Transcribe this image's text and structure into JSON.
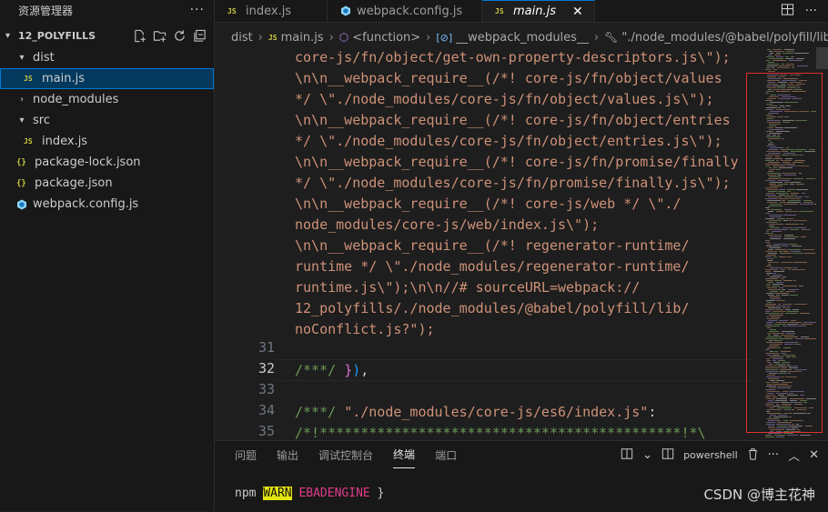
{
  "sidebar": {
    "title": "资源管理器",
    "more": "···",
    "project": "12_POLYFILLS",
    "items": [
      {
        "label": "dist",
        "type": "folder-open"
      },
      {
        "label": "main.js",
        "type": "js"
      },
      {
        "label": "node_modules",
        "type": "folder"
      },
      {
        "label": "src",
        "type": "folder-open"
      },
      {
        "label": "index.js",
        "type": "js"
      },
      {
        "label": "package-lock.json",
        "type": "json"
      },
      {
        "label": "package.json",
        "type": "json"
      },
      {
        "label": "webpack.config.js",
        "type": "webpack"
      }
    ]
  },
  "tabs": [
    {
      "label": "index.js",
      "icon": "JS"
    },
    {
      "label": "webpack.config.js",
      "icon": "webpack-icon"
    },
    {
      "label": "main.js",
      "icon": "JS",
      "active": true,
      "close": "✕"
    }
  ],
  "breadcrumb": {
    "parts": [
      "dist",
      "main.js",
      "<function>",
      "__webpack_modules__",
      "\"./node_modules/@babel/polyfill/lib/noC"
    ]
  },
  "editor": {
    "lines": [
      "core-js/fn/object/get-own-property-descriptors.js\\\");",
      "\\n\\n__webpack_require__(/*! core-js/fn/object/values",
      "*/ \\\"./node_modules/core-js/fn/object/values.js\\\");",
      "\\n\\n__webpack_require__(/*! core-js/fn/object/entries",
      "*/ \\\"./node_modules/core-js/fn/object/entries.js\\\");",
      "\\n\\n__webpack_require__(/*! core-js/fn/promise/finally",
      "*/ \\\"./node_modules/core-js/fn/promise/finally.js\\\");",
      "\\n\\n__webpack_require__(/*! core-js/web */ \\\"./",
      "node_modules/core-js/web/index.js\\\");",
      "\\n\\n__webpack_require__(/*! regenerator-runtime/",
      "runtime */ \\\"./node_modules/regenerator-runtime/",
      "runtime.js\\\");\\n\\n//# sourceURL=webpack://",
      "12_polyfills/./node_modules/@babel/polyfill/lib/",
      "noConflict.js?\");"
    ],
    "line31": "31",
    "line32": "32",
    "line32_comment": "/***/",
    "line32_close": "}),",
    "line33": "33",
    "line34": "34",
    "line34_comment": "/***/",
    "line34_str": "\"./node_modules/core-js/es6/index.js\"",
    "line34_colon": ":",
    "line35": "35",
    "line35_text": "/*!********************************************!*\\"
  },
  "panel": {
    "tabs": [
      "问题",
      "输出",
      "调试控制台",
      "终端",
      "端口"
    ],
    "active_tab": "终端",
    "shell": "powershell",
    "terminal": {
      "npm": "npm",
      "warn": "WARN",
      "code": "EBADENGINE",
      "rest": " }"
    }
  },
  "watermark": "CSDN @博主花神",
  "colors": {
    "accent": "#0078d4",
    "string": "#ce9178",
    "comment": "#6a9955",
    "js_icon": "#cbcb41"
  }
}
